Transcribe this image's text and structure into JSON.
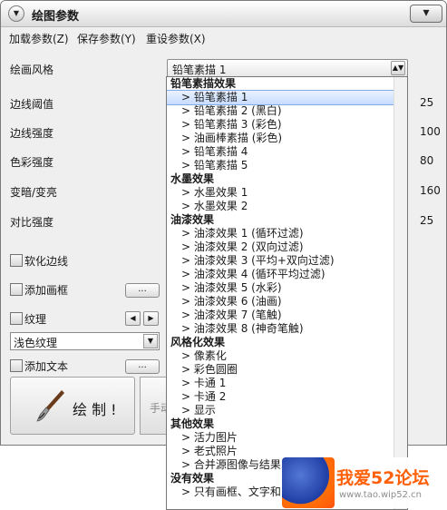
{
  "window": {
    "title": "绘图参数",
    "close_glyph": "▾"
  },
  "menubar": [
    {
      "label": "加载参数(Z)"
    },
    {
      "label": "保存参数(Y)"
    },
    {
      "label": "重设参数(X)"
    }
  ],
  "rows": {
    "style_label": "绘画风格",
    "edge_threshold": {
      "label": "边线阈值",
      "value": "25"
    },
    "edge_strength": {
      "label": "边线强度",
      "value": "100"
    },
    "color_strength": {
      "label": "色彩强度",
      "value": "80"
    },
    "darken_lighten": {
      "label": "变暗/变亮",
      "value": "160"
    },
    "contrast": {
      "label": "对比强度",
      "value": "25"
    }
  },
  "style_combo": {
    "selected": "铅笔素描 1"
  },
  "options": {
    "soften_edges": "软化边线",
    "add_frame": "添加画框",
    "texture": "纹理",
    "texture_value": "浅色纹理",
    "add_text": "添加文本",
    "ellipsis": "..."
  },
  "buttons": {
    "draw": "绘 制 !",
    "manual": "手动"
  },
  "dropdown": {
    "groups": [
      {
        "title": "铅笔素描效果",
        "items": [
          "铅笔素描 1",
          "铅笔素描 2 (黑白)",
          "铅笔素描 3 (彩色)",
          "油画棒素描 (彩色)",
          "铅笔素描 4",
          "铅笔素描 5"
        ]
      },
      {
        "title": "水墨效果",
        "items": [
          "水墨效果 1",
          "水墨效果 2"
        ]
      },
      {
        "title": "油漆效果",
        "items": [
          "油漆效果 1 (循环过滤)",
          "油漆效果 2 (双向过滤)",
          "油漆效果 3 (平均+双向过滤)",
          "油漆效果 4 (循环平均过滤)",
          "油漆效果 5 (水彩)",
          "油漆效果 6 (油画)",
          "油漆效果 7 (笔触)",
          "油漆效果 8 (神奇笔触)"
        ]
      },
      {
        "title": "风格化效果",
        "items": [
          "像素化",
          "彩色圆圈",
          "卡通 1",
          "卡通 2",
          "显示"
        ]
      },
      {
        "title": "其他效果",
        "items": [
          "活力图片",
          "老式照片",
          "合并源图像与结果"
        ]
      },
      {
        "title": "没有效果",
        "items": [
          "只有画框、文字和"
        ]
      }
    ],
    "item_prefix": "> "
  },
  "watermark": {
    "title": "我爱52论坛",
    "url": "www.tao.wip52.cn"
  }
}
